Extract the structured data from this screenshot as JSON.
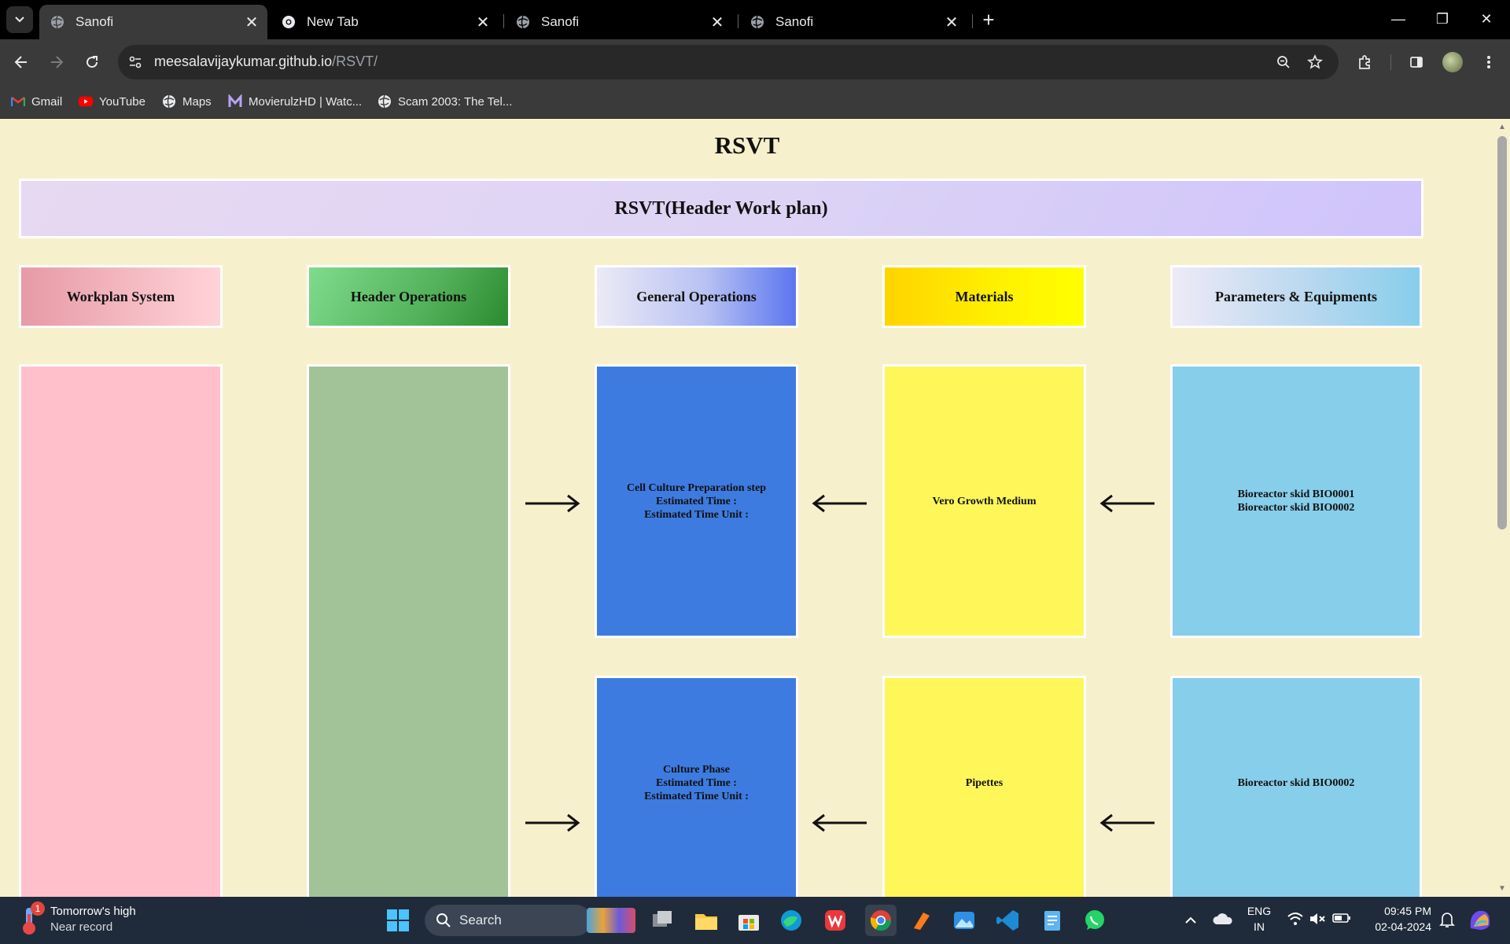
{
  "browser": {
    "tabs": [
      {
        "title": "Sanofi",
        "active": true,
        "icon": "globe-icon"
      },
      {
        "title": "New Tab",
        "active": false,
        "icon": "chrome-icon"
      },
      {
        "title": "Sanofi",
        "active": false,
        "icon": "globe-icon"
      },
      {
        "title": "Sanofi",
        "active": false,
        "icon": "globe-icon"
      }
    ],
    "url_host": "meesalavijaykumar.github.io",
    "url_path": "/RSVT/",
    "bookmarks": [
      {
        "label": "Gmail",
        "icon": "gmail-icon"
      },
      {
        "label": "YouTube",
        "icon": "youtube-icon"
      },
      {
        "label": "Maps",
        "icon": "globe-icon"
      },
      {
        "label": "MovierulzHD | Watc...",
        "icon": "movierulz-icon"
      },
      {
        "label": "Scam 2003: The Tel...",
        "icon": "globe-icon"
      }
    ]
  },
  "page": {
    "title": "RSVT",
    "header_plan": "RSVT(Header Work plan)",
    "columns": {
      "workplan": "Workplan System",
      "header_ops": "Header Operations",
      "general_ops": "General Operations",
      "materials": "Materials",
      "params": "Parameters & Equipments"
    },
    "rows": [
      {
        "operation": [
          "Cell Culture Preparation step",
          "Estimated Time :",
          "Estimated Time Unit :"
        ],
        "material": "Vero Growth Medium",
        "equipment": [
          "Bioreactor skid BIO0001",
          "Bioreactor skid BIO0002"
        ]
      },
      {
        "operation": [
          "Culture Phase",
          "Estimated Time :",
          "Estimated Time Unit :"
        ],
        "material": "Pipettes",
        "equipment": [
          "Bioreactor skid BIO0002"
        ]
      }
    ]
  },
  "taskbar": {
    "weather_title": "Tomorrow's high",
    "weather_sub": "Near record",
    "weather_badge": "1",
    "search_label": "Search",
    "lang_top": "ENG",
    "lang_bottom": "IN",
    "time": "09:45 PM",
    "date": "02-04-2024"
  },
  "colors": {
    "page_bg": "#f7f0cc",
    "workplan": "#ffc0cb",
    "header_ops": "#a2c398",
    "general_ops": "#3d7be0",
    "materials": "#fff65a",
    "params": "#87ceeb"
  }
}
